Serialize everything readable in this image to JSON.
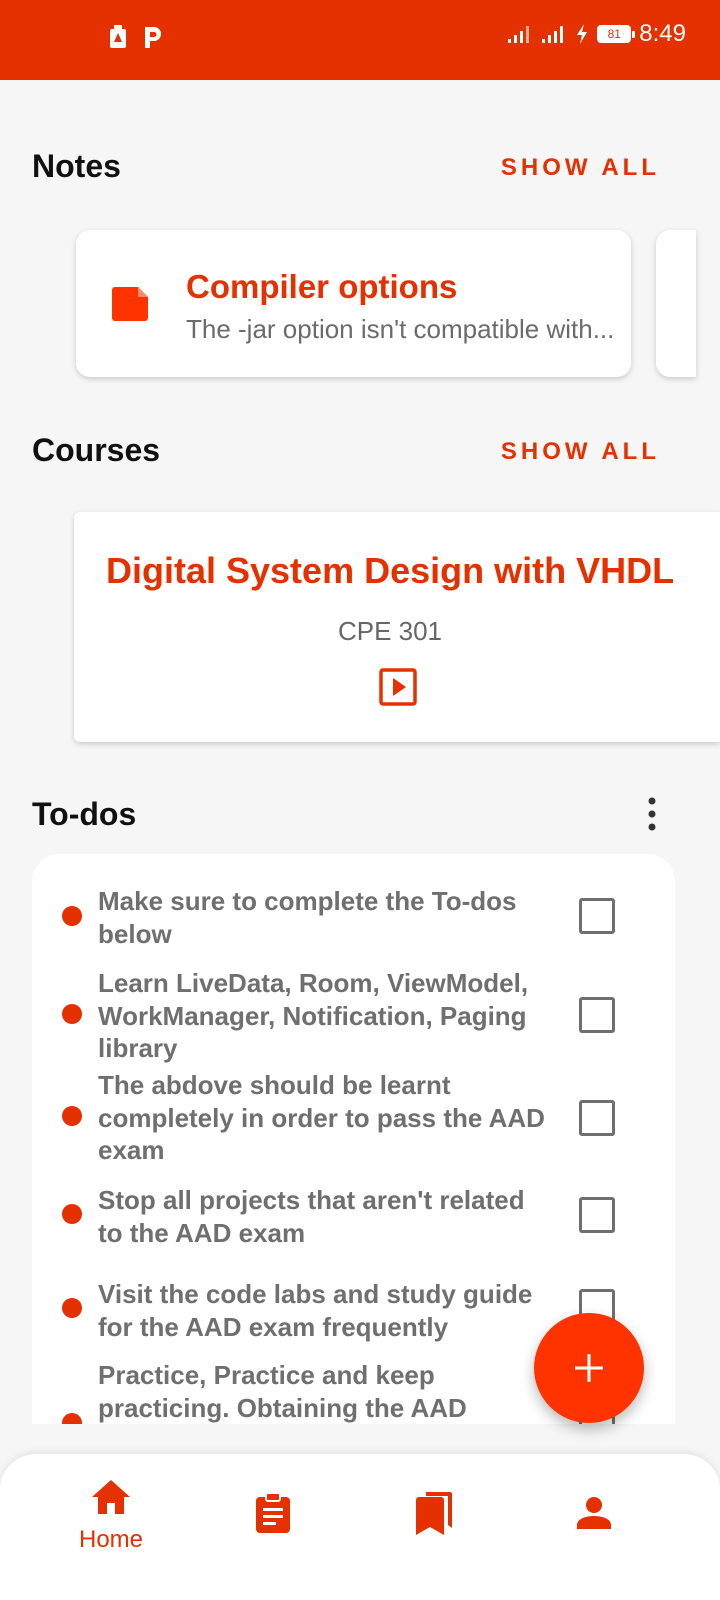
{
  "status_bar": {
    "time": "8:49",
    "battery": "81",
    "left_icons": [
      "drive-icon",
      "parking-icon"
    ],
    "right_icons": [
      "signal-icon",
      "signal-icon",
      "charging-icon",
      "battery-icon"
    ]
  },
  "notes": {
    "title": "Notes",
    "show_all": "SHOW ALL",
    "cards": [
      {
        "title": "Compiler options",
        "subtitle": "The -jar option isn't compatible with...",
        "icon": "note-icon"
      }
    ]
  },
  "courses": {
    "title": "Courses",
    "show_all": "SHOW ALL",
    "cards": [
      {
        "title": "Digital System Design with VHDL",
        "code": "CPE 301",
        "icon": "play-icon"
      }
    ]
  },
  "todos": {
    "title": "To-dos",
    "menu_icon": "more-vert-icon",
    "items": [
      {
        "text": "Make sure to complete the To-dos below",
        "checked": false
      },
      {
        "text": "Learn LiveData, Room, ViewModel, WorkManager, Notification, Paging library",
        "checked": false
      },
      {
        "text": "The abdove should be learnt completely in order to pass the AAD exam",
        "checked": false
      },
      {
        "text": "Stop all projects that aren't related to the AAD exam",
        "checked": false
      },
      {
        "text": "Visit the code labs and study guide for the AAD exam frequently",
        "checked": false
      },
      {
        "text": "Practice, Practice and keep practicing. Obtaining the AAD",
        "checked": false
      }
    ]
  },
  "fab": {
    "icon": "plus-icon"
  },
  "bottom_nav": {
    "items": [
      {
        "label": "Home",
        "icon": "home-icon",
        "active": true
      },
      {
        "label": "",
        "icon": "assignment-icon",
        "active": false
      },
      {
        "label": "",
        "icon": "bookmarks-icon",
        "active": false
      },
      {
        "label": "",
        "icon": "person-icon",
        "active": false
      }
    ]
  },
  "colors": {
    "accent": "#e53000",
    "text_gray": "#6f6f6f",
    "background": "#f6f6f6"
  }
}
